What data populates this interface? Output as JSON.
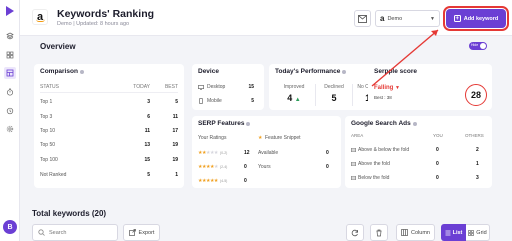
{
  "header": {
    "title": "Keywords' Ranking",
    "subtitle": "Demo | Updated: 8 hours ago",
    "profile_value": "Demo",
    "add_keyword_label": "Add keyword"
  },
  "overview": {
    "label": "Overview",
    "toggle_label": "Hide"
  },
  "comparison": {
    "title": "Comparison",
    "columns": [
      "STATUS",
      "TODAY",
      "BEST"
    ],
    "rows": [
      {
        "status": "Top 1",
        "today": "3",
        "best": "5"
      },
      {
        "status": "Top 3",
        "today": "6",
        "best": "11"
      },
      {
        "status": "Top 10",
        "today": "11",
        "best": "17"
      },
      {
        "status": "Top 50",
        "today": "13",
        "best": "19"
      },
      {
        "status": "Top 100",
        "today": "15",
        "best": "19"
      },
      {
        "status": "Not Ranked",
        "today": "5",
        "best": "1"
      }
    ]
  },
  "device": {
    "title": "Device",
    "rows": [
      {
        "label": "Desktop",
        "value": "15"
      },
      {
        "label": "Mobile",
        "value": "5"
      }
    ]
  },
  "performance": {
    "title": "Today's Performance",
    "improved_label": "Improved",
    "improved_value": "4",
    "declined_label": "Declined",
    "declined_value": "5",
    "nochange_label": "No Change",
    "nochange_value": "11"
  },
  "serpple": {
    "title": "Serpple score",
    "status": "Falling",
    "best": "Best : 38",
    "score": "28"
  },
  "serp_features": {
    "title": "SERP Features",
    "ratings_label": "Your Ratings",
    "snippet_label": "Feature Snippet",
    "ratings": [
      {
        "range": "(0-2)",
        "value": "12"
      },
      {
        "range": "(2-4)",
        "value": "0"
      },
      {
        "range": "(4-5)",
        "value": "0"
      }
    ],
    "snippet_rows": [
      {
        "label": "Available",
        "value": "0"
      },
      {
        "label": "Yours",
        "value": "0"
      }
    ]
  },
  "google_ads": {
    "title": "Google Search Ads",
    "columns": [
      "AREA",
      "YOU",
      "OTHERS"
    ],
    "rows": [
      {
        "area": "Above & below the fold",
        "you": "0",
        "others": "2"
      },
      {
        "area": "Above the fold",
        "you": "0",
        "others": "1"
      },
      {
        "area": "Below the fold",
        "you": "0",
        "others": "3"
      }
    ]
  },
  "keywords": {
    "total_label": "Total keywords (20)",
    "search_placeholder": "Search",
    "export_label": "Export",
    "column_label": "Column",
    "list_label": "List",
    "grid_label": "Grid"
  },
  "user": {
    "avatar_initial": "B"
  },
  "colors": {
    "accent": "#6b3fd4",
    "danger": "#e53935",
    "success": "#2e9e5b",
    "star": "#f0a020"
  }
}
